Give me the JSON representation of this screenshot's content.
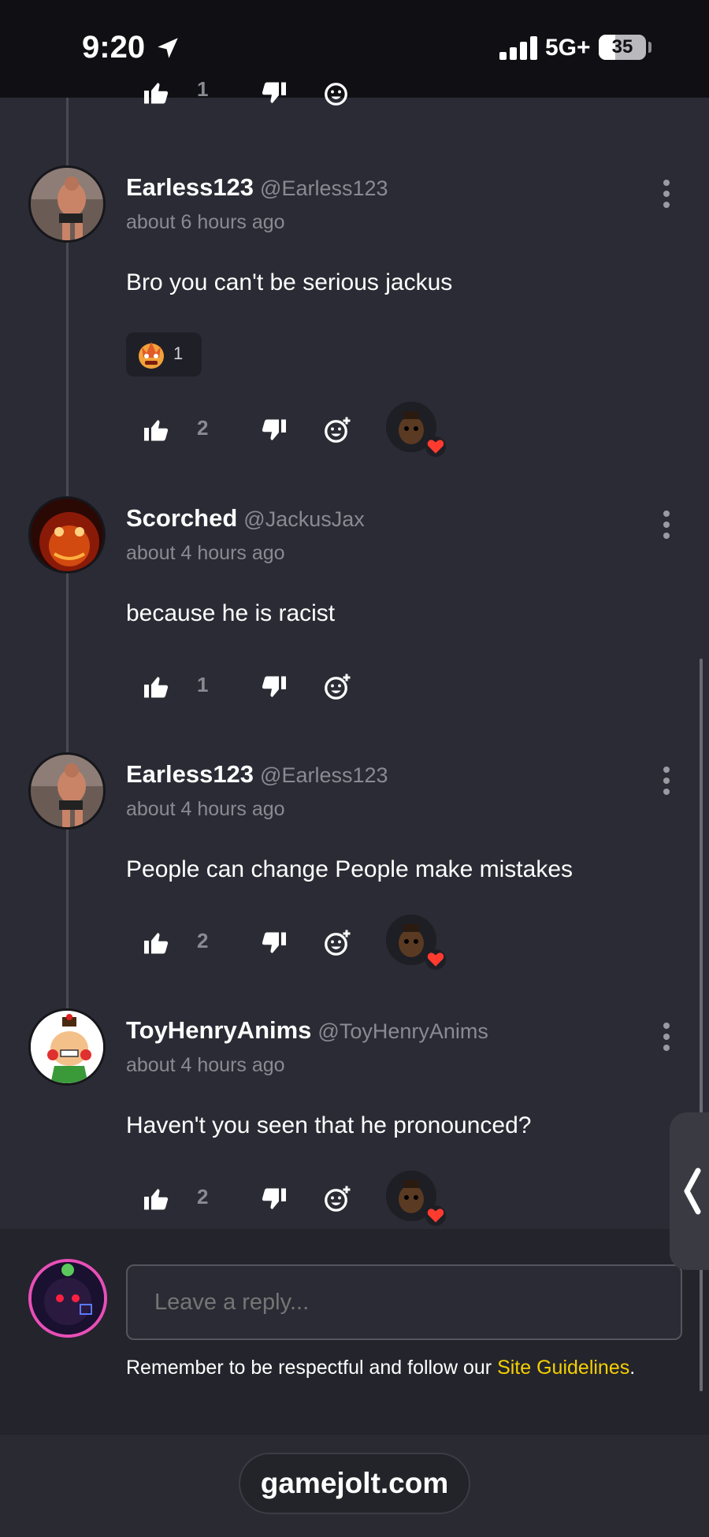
{
  "status_bar": {
    "time": "9:20",
    "network": "5G+",
    "battery": "35",
    "battery_level_percent": 35
  },
  "comments": [
    {
      "top_partial": true,
      "upvotes": "1"
    },
    {
      "name": "Earless123",
      "handle": "@Earless123",
      "time": "about 6 hours ago",
      "text": "Bro you can't be serious jackus",
      "reaction_count": "1",
      "upvotes": "2"
    },
    {
      "name": "Scorched",
      "handle": "@JackusJax",
      "time": "about 4 hours ago",
      "text": "because he is racist",
      "upvotes": "1"
    },
    {
      "name": "Earless123",
      "handle": "@Earless123",
      "time": "about 4 hours ago",
      "text": "People can change People make mistakes",
      "upvotes": "2"
    },
    {
      "name": "ToyHenryAnims",
      "handle": "@ToyHenryAnims",
      "time": "about 4 hours ago",
      "text": "Haven't you seen that he pronounced?",
      "upvotes": "2"
    }
  ],
  "reply": {
    "placeholder": "Leave a reply...",
    "guidelines_prefix": "Remember to be respectful and follow our ",
    "guidelines_link": "Site Guidelines",
    "guidelines_suffix": "."
  },
  "browser": {
    "url": "gamejolt.com"
  },
  "colors": {
    "background": "#2b2b35",
    "link": "#f5d000",
    "heart": "#ff3b30",
    "muted_text": "#8a8a93"
  }
}
